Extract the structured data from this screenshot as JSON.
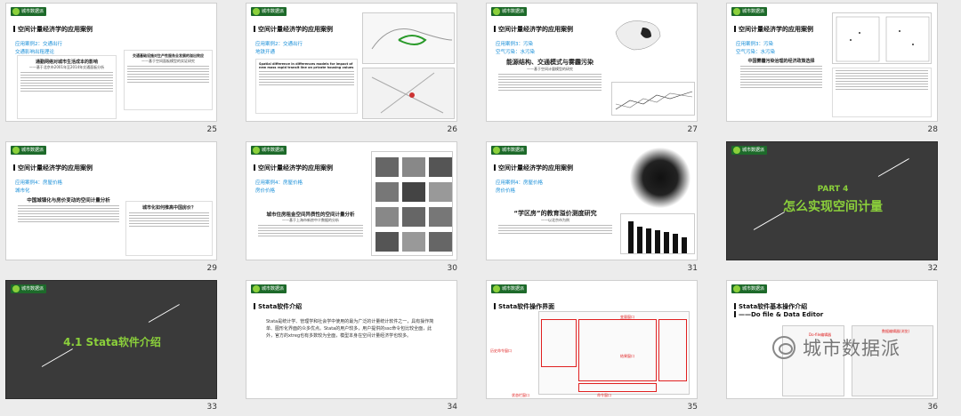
{
  "logo_text": "城市数据派",
  "section_title": "空间计量经济学的应用案例",
  "slides": [
    {
      "num": "25",
      "subs": [
        "应用案例2：交通出行",
        "交通影响出租理论"
      ],
      "paper_title": "通勤网络对城市生活成本的影响",
      "paper_sub": "——基于北京市2001年至2014年交通面板分析",
      "paper2_title": "交通基础设施对生产性服务业发展的溢出效应",
      "paper2_sub": "——基于空间面板模型的实证研究"
    },
    {
      "num": "26",
      "subs": [
        "应用案例2：交通出行",
        "地铁开通"
      ],
      "paper_title": "Spatial difference in differences models for impact of new mass rapid transit line on private housing values"
    },
    {
      "num": "27",
      "subs": [
        "应用案例3：污染",
        "空气污染：水污染"
      ],
      "paper_title": "能源结构、交通模式与雾霾污染",
      "paper_sub": "——基于空间计量模型的研究"
    },
    {
      "num": "28",
      "subs": [
        "应用案例3：污染",
        "空气污染：水污染"
      ],
      "paper_title": "中国雾霾污染治理的经济政策选择"
    },
    {
      "num": "29",
      "subs": [
        "应用案例4：房屋价格",
        "城市化"
      ],
      "paper_title": "中国城镇化与房价变动的空间计量分析",
      "paper2_title": "城市化如何推高中国房价？"
    },
    {
      "num": "30",
      "subs": [
        "应用案例4：房屋价格",
        "房价价格"
      ],
      "paper_title": "城市住房租金空间异质性的空间计量分析",
      "paper_sub": "——基于上海市新房中介数据的分析"
    },
    {
      "num": "31",
      "subs": [
        "应用案例4：房屋价格",
        "房价价格"
      ],
      "paper_title": "“学区房”的教育溢价测度研究",
      "paper_sub": "——以北京市为例"
    },
    {
      "num": "32",
      "part": "PART 4",
      "part_title": "怎么实现空间计量"
    },
    {
      "num": "33",
      "part_title": "4.1 Stata软件介绍"
    },
    {
      "num": "34",
      "title": "Stata软件介绍",
      "body": "Stata是统计学、管理学和社会学中使用的最为广泛的计量统计软件之一，具有操作简单、图形化界面的众多优点。Stata的用户较多，用户提供的ssc命令包比较全面，此外，官方的xtreg也有多数较为全面，模型本身在空间计量经济学也较多。"
    },
    {
      "num": "35",
      "title": "Stata软件操作界面",
      "labels": [
        "历史命令窗口",
        "变量窗口",
        "结果窗口",
        "命令窗口",
        "状态栏窗口"
      ]
    },
    {
      "num": "36",
      "title": "Stata软件基本操作介绍",
      "title2": "——Do file & Data Editor",
      "labels": [
        "Do-file编辑器",
        "数据编辑器(浏览)"
      ]
    }
  ],
  "watermark": "城市数据派"
}
